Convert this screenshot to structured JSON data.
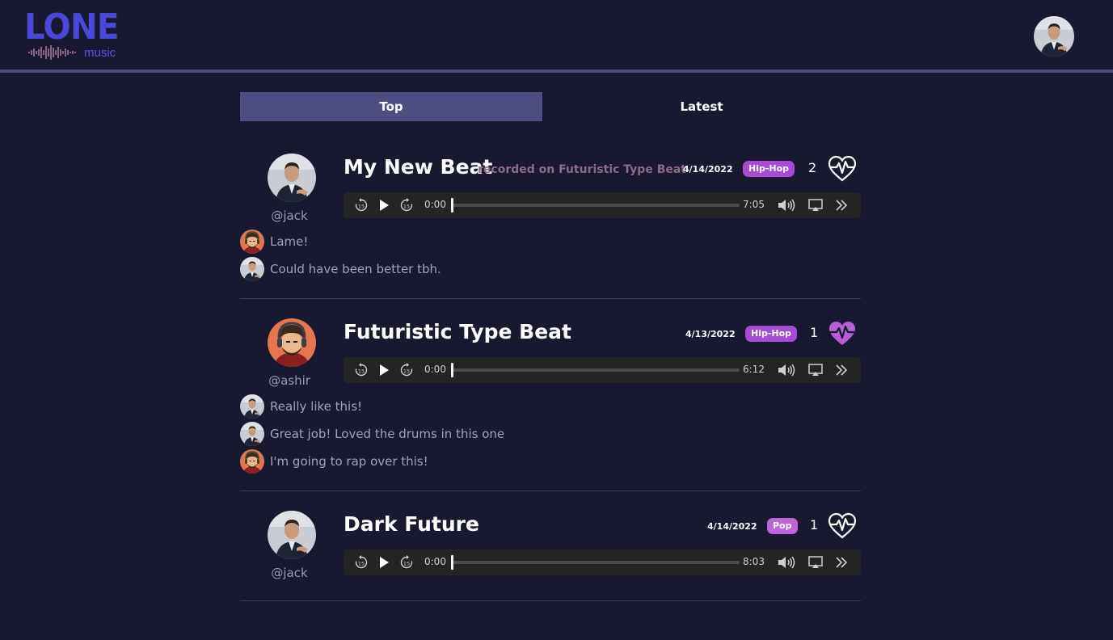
{
  "app": {
    "logo_word": "LONE",
    "logo_sub": "music"
  },
  "tabs": [
    {
      "label": "Top",
      "active": true
    },
    {
      "label": "Latest",
      "active": false
    }
  ],
  "colors": {
    "background": "#181830",
    "accent": "#4f4e82",
    "logo": "#4b48d9",
    "liked_heart": "#b65fd6",
    "genre_hiphop": "#a54bd6",
    "genre_pop": "#c065d9"
  },
  "posts": [
    {
      "author": "@jack",
      "title": "My New Beat",
      "recorded_on": "recorded on Futuristic Type Beat",
      "date": "4/14/2022",
      "genre": "Hip-Hop",
      "likes": "2",
      "liked": false,
      "player": {
        "current": "0:00",
        "duration": "7:05"
      },
      "comments": [
        {
          "avatar": "ashir",
          "text": "Lame!"
        },
        {
          "avatar": "jack",
          "text": "Could have been better tbh."
        }
      ]
    },
    {
      "author": "@ashir",
      "title": "Futuristic Type Beat",
      "recorded_on": "",
      "date": "4/13/2022",
      "genre": "Hip-Hop",
      "likes": "1",
      "liked": true,
      "player": {
        "current": "0:00",
        "duration": "6:12"
      },
      "comments": [
        {
          "avatar": "jack",
          "text": "Really like this!"
        },
        {
          "avatar": "jack",
          "text": "Great job! Loved the drums in this one"
        },
        {
          "avatar": "ashir",
          "text": "I'm going to rap over this!"
        }
      ]
    },
    {
      "author": "@jack",
      "title": "Dark Future",
      "recorded_on": "",
      "date": "4/14/2022",
      "genre": "Pop",
      "likes": "1",
      "liked": false,
      "player": {
        "current": "0:00",
        "duration": "8:03"
      },
      "comments": []
    }
  ]
}
